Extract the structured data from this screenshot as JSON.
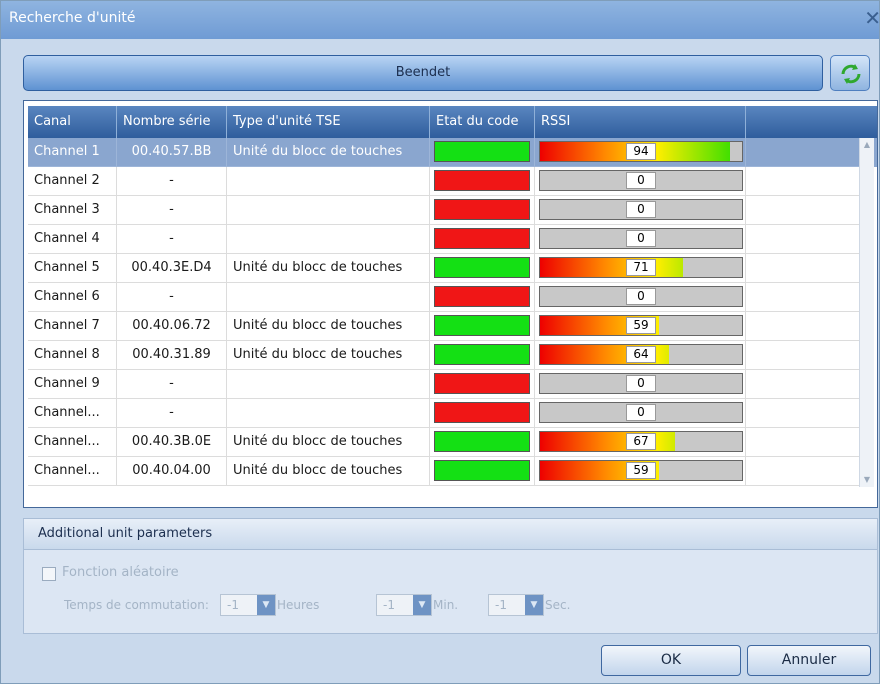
{
  "window": {
    "title": "Recherche d'unité",
    "close_glyph": "✕"
  },
  "status_bar": {
    "label": "Beendet"
  },
  "refresh_button": {
    "icon": "refresh-icon"
  },
  "table": {
    "columns": [
      "Canal",
      "Nombre série",
      "Type d'unité TSE",
      "Etat du code",
      "RSSI"
    ],
    "rows": [
      {
        "canal": "Channel 1",
        "serial": "00.40.57.BB",
        "type": "Unité du blocc de touches",
        "etat": "green",
        "rssi": 94,
        "rssi_label": "94",
        "selected": true
      },
      {
        "canal": "Channel 2",
        "serial": "-",
        "type": "",
        "etat": "red",
        "rssi": 0,
        "rssi_label": "0",
        "selected": false
      },
      {
        "canal": "Channel 3",
        "serial": "-",
        "type": "",
        "etat": "red",
        "rssi": 0,
        "rssi_label": "0",
        "selected": false
      },
      {
        "canal": "Channel 4",
        "serial": "-",
        "type": "",
        "etat": "red",
        "rssi": 0,
        "rssi_label": "0",
        "selected": false
      },
      {
        "canal": "Channel 5",
        "serial": "00.40.3E.D4",
        "type": "Unité du blocc de touches",
        "etat": "green",
        "rssi": 71,
        "rssi_label": "71",
        "selected": false
      },
      {
        "canal": "Channel 6",
        "serial": "-",
        "type": "",
        "etat": "red",
        "rssi": 0,
        "rssi_label": "0",
        "selected": false
      },
      {
        "canal": "Channel 7",
        "serial": "00.40.06.72",
        "type": "Unité du blocc de touches",
        "etat": "green",
        "rssi": 59,
        "rssi_label": "59",
        "selected": false
      },
      {
        "canal": "Channel 8",
        "serial": "00.40.31.89",
        "type": "Unité du blocc de touches",
        "etat": "green",
        "rssi": 64,
        "rssi_label": "64",
        "selected": false
      },
      {
        "canal": "Channel 9",
        "serial": "-",
        "type": "",
        "etat": "red",
        "rssi": 0,
        "rssi_label": "0",
        "selected": false
      },
      {
        "canal": "Channel...",
        "serial": "-",
        "type": "",
        "etat": "red",
        "rssi": 0,
        "rssi_label": "0",
        "selected": false
      },
      {
        "canal": "Channel...",
        "serial": "00.40.3B.0E",
        "type": "Unité du blocc de touches",
        "etat": "green",
        "rssi": 67,
        "rssi_label": "67",
        "selected": false
      },
      {
        "canal": "Channel...",
        "serial": "00.40.04.00",
        "type": "Unité du blocc de touches",
        "etat": "green",
        "rssi": 59,
        "rssi_label": "59",
        "selected": false
      }
    ]
  },
  "colors": {
    "etat_green": "#14e014",
    "etat_red": "#f01616",
    "selected_row": "#8aa6cf"
  },
  "params": {
    "title": "Additional unit parameters",
    "random_function_label": "Fonction aléatoire",
    "switch_time_label": "Temps de commutation:",
    "hours_value": "-1",
    "hours_unit": "Heures",
    "minutes_value": "-1",
    "minutes_unit": "Min.",
    "seconds_value": "-1",
    "seconds_unit": "Sec."
  },
  "buttons": {
    "ok": "OK",
    "cancel": "Annuler"
  }
}
